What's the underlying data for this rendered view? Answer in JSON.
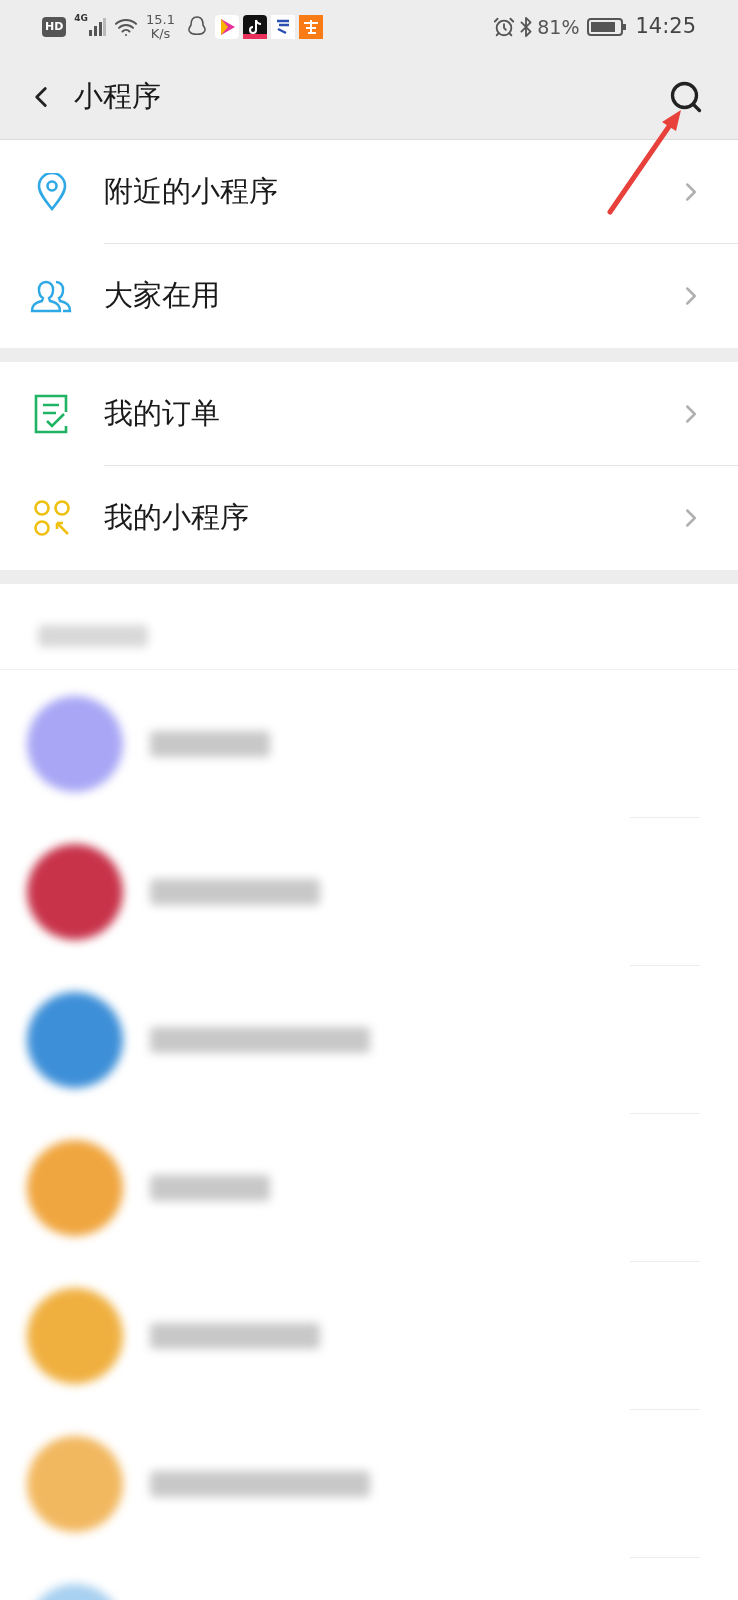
{
  "status_bar": {
    "left": [
      "HD",
      "4G"
    ],
    "speed": [
      "15.1",
      "K/s"
    ],
    "battery": "81%",
    "time": "14:25"
  },
  "header": {
    "title": "小程序"
  },
  "sections": [
    {
      "items": [
        {
          "kind": "location",
          "label": "附近的小程序"
        },
        {
          "kind": "people",
          "label": "大家在用"
        }
      ]
    },
    {
      "items": [
        {
          "kind": "order",
          "label": "我的订单"
        },
        {
          "kind": "apps",
          "label": "我的小程序"
        }
      ]
    }
  ],
  "blurred_items": [
    {
      "color": "#a9a7f5"
    },
    {
      "color": "#c8334a"
    },
    {
      "color": "#3d8fd8"
    },
    {
      "color": "#f0a640"
    },
    {
      "color": "#f0b040"
    },
    {
      "color": "#f2b860"
    },
    {
      "color": "#a8d0f0"
    }
  ]
}
